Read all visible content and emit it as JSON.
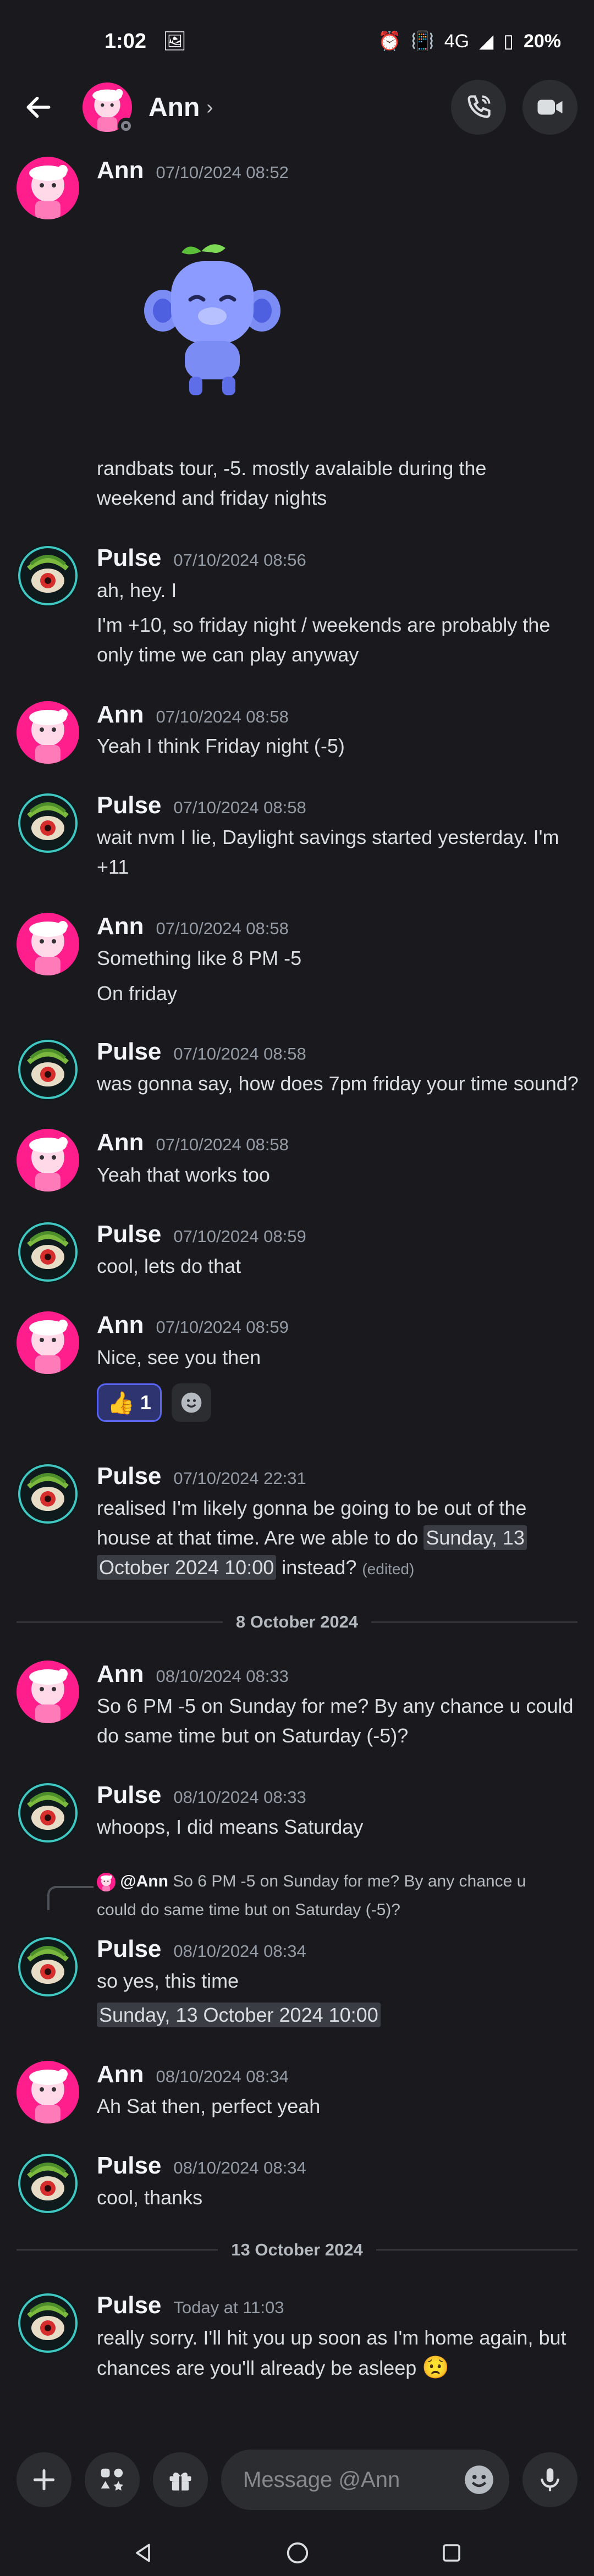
{
  "status": {
    "time": "1:02",
    "battery": "20%",
    "network": "4G"
  },
  "header": {
    "title": "Ann",
    "chevron": "›"
  },
  "colors": {
    "background": "#1a1a1e",
    "accent": "#5865f2"
  },
  "dividers": [
    "8 October 2024",
    "13 October 2024"
  ],
  "messages": {
    "m1": {
      "author": "Ann",
      "ts": "07/10/2024 08:52",
      "text": "randbats tour, -5. mostly avalaible during the",
      "text2": "weekend and friday nights"
    },
    "m2": {
      "author": "Pulse",
      "ts": "07/10/2024 08:56",
      "text": "ah, hey. I",
      "text2": "I'm +10, so friday night / weekends are probably the",
      "text3": "only time we can play anyway"
    },
    "m3": {
      "author": "Ann",
      "ts": "07/10/2024 08:58",
      "text": "Yeah I think Friday night (-5)"
    },
    "m4": {
      "author": "Pulse",
      "ts": "07/10/2024 08:58",
      "text": "wait nvm I lie, Daylight savings started yesterday. I'm",
      "text2": "+11"
    },
    "m5": {
      "author": "Ann",
      "ts": "07/10/2024 08:58",
      "text": "Something like 8 PM -5",
      "text2": "On friday"
    },
    "m6": {
      "author": "Pulse",
      "ts": "07/10/2024 08:58",
      "text": "was gonna say, how does 7pm friday your time sound?"
    },
    "m7": {
      "author": "Ann",
      "ts": "07/10/2024 08:58",
      "text": "Yeah that works too"
    },
    "m8": {
      "author": "Pulse",
      "ts": "07/10/2024 08:59",
      "text": "cool, lets do that"
    },
    "m9": {
      "author": "Ann",
      "ts": "07/10/2024 08:59",
      "text": "Nice, see you then",
      "reaction_count": "1"
    },
    "m10": {
      "author": "Pulse",
      "ts": "07/10/2024 22:31",
      "text": "realised I'm likely gonna be going to be out of the",
      "text2": "house at that time. Are we able to do ",
      "chip_a": "Sunday, 13",
      "chip_b": "October 2024 10:00",
      "text3": " instead?",
      "edited": "(edited)"
    },
    "m11": {
      "author": "Ann",
      "ts": "08/10/2024 08:33",
      "text": "So 6 PM -5 on Sunday for me? By any chance u could",
      "text2": "do same time but on Saturday (-5)?"
    },
    "m12": {
      "author": "Pulse",
      "ts": "08/10/2024 08:33",
      "text": "whoops, I did means Saturday"
    },
    "m13": {
      "reply_name": "@Ann",
      "reply_text": "So 6 PM -5 on Sunday for me? By any chance u",
      "reply_text2": "could do same time but on Saturday (-5)?",
      "author": "Pulse",
      "ts": "08/10/2024 08:34",
      "text": "so yes, this time",
      "chip": "Sunday, 13 October 2024 10:00"
    },
    "m14": {
      "author": "Ann",
      "ts": "08/10/2024 08:34",
      "text": "Ah Sat then, perfect yeah"
    },
    "m15": {
      "author": "Pulse",
      "ts": "08/10/2024 08:34",
      "text": "cool, thanks"
    },
    "m16": {
      "author": "Pulse",
      "ts": "Today at 11:03",
      "text": "really sorry. I'll hit you up soon as I'm home again, but",
      "text2": "chances are you'll already be asleep"
    }
  },
  "composer": {
    "placeholder": "Message @Ann"
  }
}
